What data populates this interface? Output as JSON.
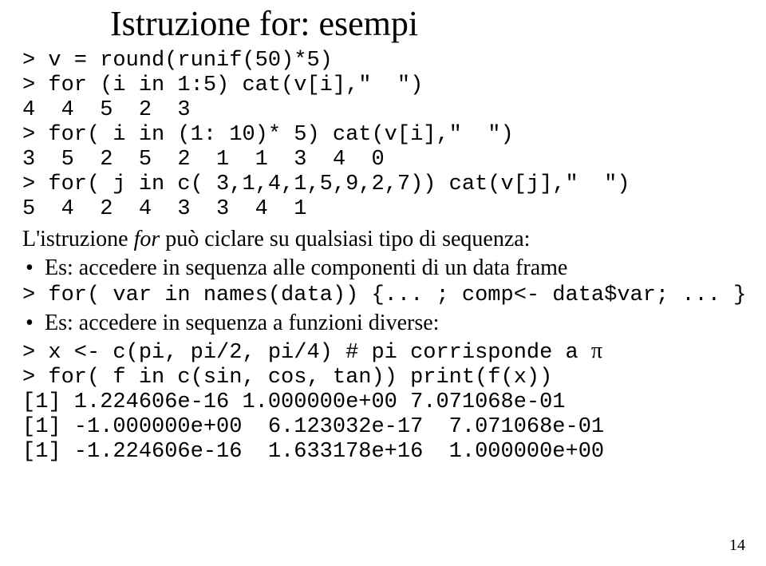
{
  "title": "Istruzione for: esempi",
  "code1": "> v = round(runif(50)*5)\n> for (i in 1:5) cat(v[i],\"  \")\n4  4  5  2  3\n> for( i in (1: 10)* 5) cat(v[i],\"  \")\n3  5  2  5  2  1  1  3  4  0\n> for( j in c( 3,1,4,1,5,9,2,7)) cat(v[j],\"  \")\n5  4  2  4  3  3  4  1",
  "body1_a": "L'istruzione ",
  "body1_i": "for",
  "body1_b": " può ciclare su qualsiasi tipo di sequenza:",
  "bullet1": "Es: accedere in sequenza alle componenti di un data frame",
  "code2": "> for( var in names(data)) {... ; comp<- data$var; ... }",
  "bullet2": "Es: accedere in sequenza a funzioni diverse:",
  "code3_a": "> x <- c(pi, pi/2, pi/4) # pi corrisponde a ",
  "code3_pi": "π",
  "code3_b": "\n> for( f in c(sin, cos, tan)) print(f(x))\n[1] 1.224606e-16 1.000000e+00 7.071068e-01\n[1] -1.000000e+00  6.123032e-17  7.071068e-01\n[1] -1.224606e-16  1.633178e+16  1.000000e+00",
  "page_number": "14"
}
